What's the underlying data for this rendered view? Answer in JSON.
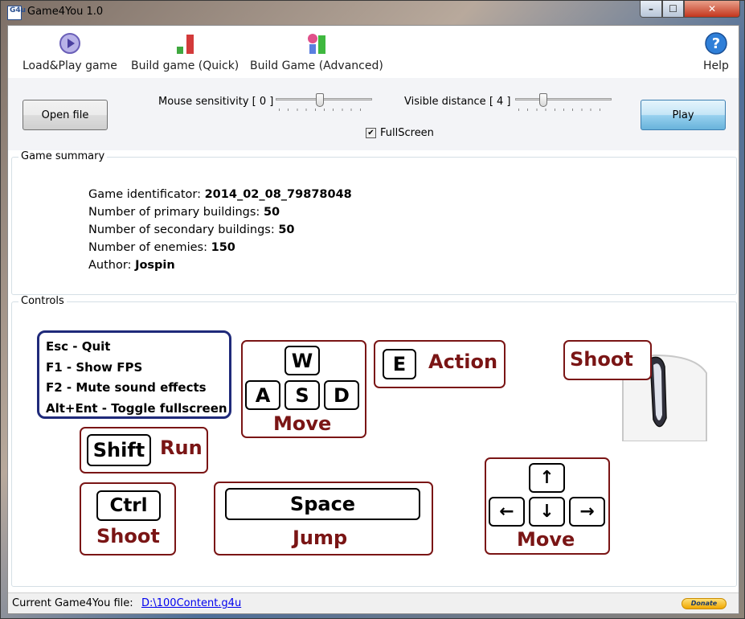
{
  "window": {
    "title": "Game4You 1.0",
    "icon_text": "G4u",
    "min": "–",
    "max": "☐",
    "close": "✕"
  },
  "toolbar": {
    "items": [
      {
        "label": "Load&Play game",
        "icon": "play-disc-icon"
      },
      {
        "label": "Build game (Quick)",
        "icon": "bars-icon"
      },
      {
        "label": "Build Game (Advanced)",
        "icon": "shapes-icon"
      },
      {
        "label": "Help",
        "icon": "help-icon"
      }
    ]
  },
  "settings": {
    "open_file": "Open file",
    "mouse_sensitivity_label": "Mouse sensitivity [ 0 ]",
    "mouse_sensitivity_value": 0,
    "mouse_sensitivity_fraction": 0.45,
    "visible_distance_label": "Visible distance [ 4 ]",
    "visible_distance_value": 4,
    "visible_distance_fraction": 0.27,
    "fullscreen_label": "FullScreen",
    "fullscreen_checked": true,
    "play": "Play"
  },
  "summary": {
    "legend": "Game summary",
    "lines": [
      {
        "label": "Game identificator: ",
        "value": "2014_02_08_79878048"
      },
      {
        "label": "Number of primary buildings: ",
        "value": "50"
      },
      {
        "label": "Number of secondary buildings: ",
        "value": "50"
      },
      {
        "label": "Number of enemies: ",
        "value": "150"
      },
      {
        "label": "Author: ",
        "value": "Jospin"
      }
    ]
  },
  "controls": {
    "legend": "Controls",
    "hotkeys": [
      "Esc - Quit",
      "F1 - Show FPS",
      "F2 - Mute sound effects",
      "Alt+Ent - Toggle fullscreen"
    ],
    "wasd": {
      "keys": [
        "W",
        "A",
        "S",
        "D"
      ],
      "label": "Move"
    },
    "action": {
      "key": "E",
      "label": "Action"
    },
    "mouse": {
      "label": "Shoot"
    },
    "shift": {
      "key": "Shift",
      "label": "Run"
    },
    "ctrl": {
      "key": "Ctrl",
      "label": "Shoot"
    },
    "space": {
      "key": "Space",
      "label": "Jump"
    },
    "arrows": {
      "keys": [
        "↑",
        "←",
        "↓",
        "→"
      ],
      "label": "Move"
    }
  },
  "status": {
    "label": "Current Game4You file:",
    "file": "D:\\100Content.g4u",
    "donate": "Donate"
  },
  "colors": {
    "accent_red": "#7a1515",
    "hotkey_border": "#1f2a7a"
  }
}
